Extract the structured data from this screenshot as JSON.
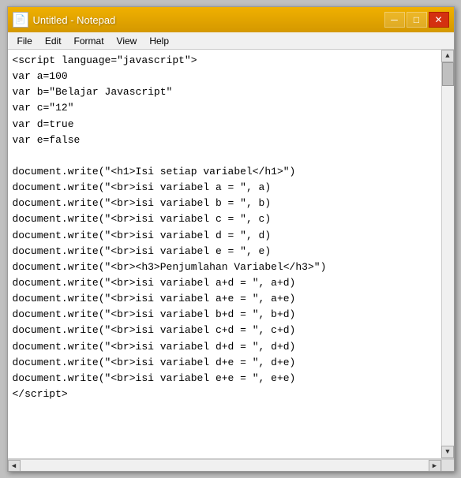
{
  "titleBar": {
    "title": "Untitled - Notepad",
    "icon": "📄",
    "minimizeLabel": "─",
    "maximizeLabel": "□",
    "closeLabel": "✕"
  },
  "menuBar": {
    "items": [
      {
        "label": "File"
      },
      {
        "label": "Edit"
      },
      {
        "label": "Format"
      },
      {
        "label": "View"
      },
      {
        "label": "Help"
      }
    ]
  },
  "editor": {
    "content": "<script language=\"javascript\">\nvar a=100\nvar b=\"Belajar Javascript\"\nvar c=\"12\"\nvar d=true\nvar e=false\n\ndocument.write(\"<h1>Isi setiap variabel</h1>\")\ndocument.write(\"<br>isi variabel a = \", a)\ndocument.write(\"<br>isi variabel b = \", b)\ndocument.write(\"<br>isi variabel c = \", c)\ndocument.write(\"<br>isi variabel d = \", d)\ndocument.write(\"<br>isi variabel e = \", e)\ndocument.write(\"<br><h3>Penjumlahan Variabel</h3>\")\ndocument.write(\"<br>isi variabel a+d = \", a+d)\ndocument.write(\"<br>isi variabel a+e = \", a+e)\ndocument.write(\"<br>isi variabel b+d = \", b+d)\ndocument.write(\"<br>isi variabel c+d = \", c+d)\ndocument.write(\"<br>isi variabel d+d = \", d+d)\ndocument.write(\"<br>isi variabel d+e = \", d+e)\ndocument.write(\"<br>isi variabel e+e = \", e+e)\n</script>"
  }
}
